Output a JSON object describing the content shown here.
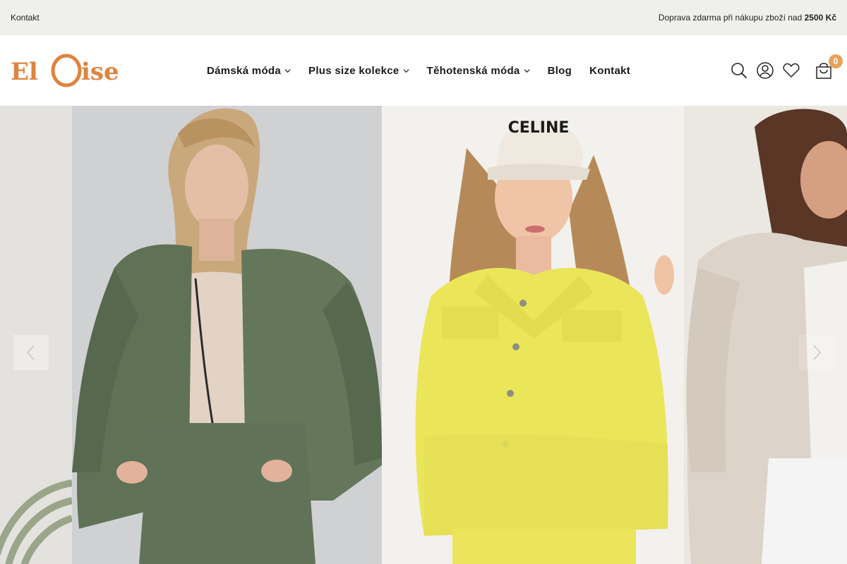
{
  "topbar": {
    "contact_link": "Kontakt",
    "shipping_text": "Doprava zdarma při nákupu zboží nad ",
    "shipping_amount": "2500 Kč"
  },
  "brand": {
    "logo_text": "ElOise",
    "color": "#e0833e"
  },
  "nav": {
    "items": [
      {
        "label": "Dámská móda",
        "has_dropdown": true
      },
      {
        "label": "Plus size kolekce",
        "has_dropdown": true
      },
      {
        "label": "Těhotenská móda",
        "has_dropdown": true
      },
      {
        "label": "Blog",
        "has_dropdown": false
      },
      {
        "label": "Kontakt",
        "has_dropdown": false
      }
    ]
  },
  "header_icons": {
    "search": "search-icon",
    "account": "user-icon",
    "wishlist": "heart-icon",
    "cart": "shopping-bag-icon",
    "cart_count": "0"
  },
  "hero": {
    "slides": [
      {
        "description": "green-bomber-jacket-outfit"
      },
      {
        "description": "yellow-denim-jacket-outfit"
      },
      {
        "description": "beige-jacket-outfit"
      }
    ],
    "cap_text": "CELINE",
    "prev_icon": "chevron-left-icon",
    "next_icon": "chevron-right-icon"
  },
  "colors": {
    "topbar_bg": "#efefeb",
    "accent": "#e8a35b",
    "green_jacket": "#5f7256",
    "yellow_jacket": "#ebe55a",
    "beige_jacket": "#ddd6cb"
  }
}
